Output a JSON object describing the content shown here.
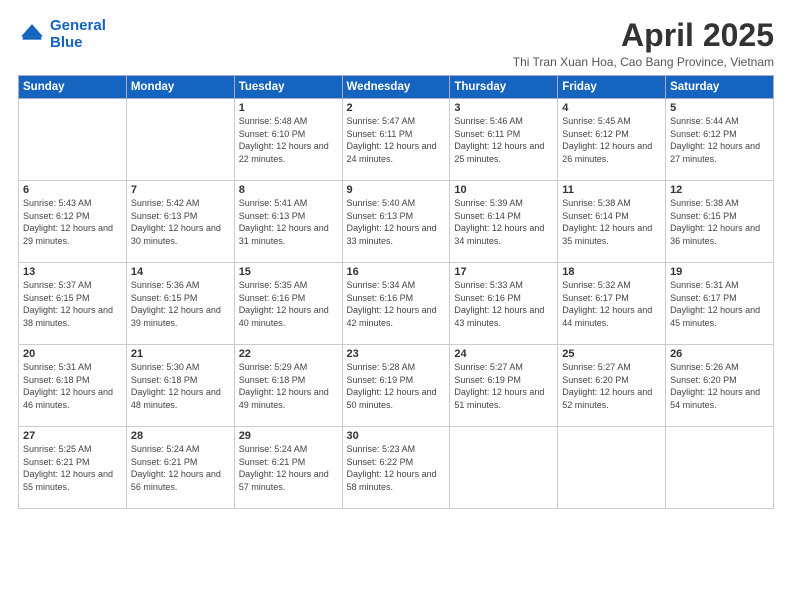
{
  "logo": {
    "line1": "General",
    "line2": "Blue"
  },
  "title": "April 2025",
  "subtitle": "Thi Tran Xuan Hoa, Cao Bang Province, Vietnam",
  "days_of_week": [
    "Sunday",
    "Monday",
    "Tuesday",
    "Wednesday",
    "Thursday",
    "Friday",
    "Saturday"
  ],
  "weeks": [
    [
      {
        "day": "",
        "info": ""
      },
      {
        "day": "",
        "info": ""
      },
      {
        "day": "1",
        "info": "Sunrise: 5:48 AM\nSunset: 6:10 PM\nDaylight: 12 hours and 22 minutes."
      },
      {
        "day": "2",
        "info": "Sunrise: 5:47 AM\nSunset: 6:11 PM\nDaylight: 12 hours and 24 minutes."
      },
      {
        "day": "3",
        "info": "Sunrise: 5:46 AM\nSunset: 6:11 PM\nDaylight: 12 hours and 25 minutes."
      },
      {
        "day": "4",
        "info": "Sunrise: 5:45 AM\nSunset: 6:12 PM\nDaylight: 12 hours and 26 minutes."
      },
      {
        "day": "5",
        "info": "Sunrise: 5:44 AM\nSunset: 6:12 PM\nDaylight: 12 hours and 27 minutes."
      }
    ],
    [
      {
        "day": "6",
        "info": "Sunrise: 5:43 AM\nSunset: 6:12 PM\nDaylight: 12 hours and 29 minutes."
      },
      {
        "day": "7",
        "info": "Sunrise: 5:42 AM\nSunset: 6:13 PM\nDaylight: 12 hours and 30 minutes."
      },
      {
        "day": "8",
        "info": "Sunrise: 5:41 AM\nSunset: 6:13 PM\nDaylight: 12 hours and 31 minutes."
      },
      {
        "day": "9",
        "info": "Sunrise: 5:40 AM\nSunset: 6:13 PM\nDaylight: 12 hours and 33 minutes."
      },
      {
        "day": "10",
        "info": "Sunrise: 5:39 AM\nSunset: 6:14 PM\nDaylight: 12 hours and 34 minutes."
      },
      {
        "day": "11",
        "info": "Sunrise: 5:38 AM\nSunset: 6:14 PM\nDaylight: 12 hours and 35 minutes."
      },
      {
        "day": "12",
        "info": "Sunrise: 5:38 AM\nSunset: 6:15 PM\nDaylight: 12 hours and 36 minutes."
      }
    ],
    [
      {
        "day": "13",
        "info": "Sunrise: 5:37 AM\nSunset: 6:15 PM\nDaylight: 12 hours and 38 minutes."
      },
      {
        "day": "14",
        "info": "Sunrise: 5:36 AM\nSunset: 6:15 PM\nDaylight: 12 hours and 39 minutes."
      },
      {
        "day": "15",
        "info": "Sunrise: 5:35 AM\nSunset: 6:16 PM\nDaylight: 12 hours and 40 minutes."
      },
      {
        "day": "16",
        "info": "Sunrise: 5:34 AM\nSunset: 6:16 PM\nDaylight: 12 hours and 42 minutes."
      },
      {
        "day": "17",
        "info": "Sunrise: 5:33 AM\nSunset: 6:16 PM\nDaylight: 12 hours and 43 minutes."
      },
      {
        "day": "18",
        "info": "Sunrise: 5:32 AM\nSunset: 6:17 PM\nDaylight: 12 hours and 44 minutes."
      },
      {
        "day": "19",
        "info": "Sunrise: 5:31 AM\nSunset: 6:17 PM\nDaylight: 12 hours and 45 minutes."
      }
    ],
    [
      {
        "day": "20",
        "info": "Sunrise: 5:31 AM\nSunset: 6:18 PM\nDaylight: 12 hours and 46 minutes."
      },
      {
        "day": "21",
        "info": "Sunrise: 5:30 AM\nSunset: 6:18 PM\nDaylight: 12 hours and 48 minutes."
      },
      {
        "day": "22",
        "info": "Sunrise: 5:29 AM\nSunset: 6:18 PM\nDaylight: 12 hours and 49 minutes."
      },
      {
        "day": "23",
        "info": "Sunrise: 5:28 AM\nSunset: 6:19 PM\nDaylight: 12 hours and 50 minutes."
      },
      {
        "day": "24",
        "info": "Sunrise: 5:27 AM\nSunset: 6:19 PM\nDaylight: 12 hours and 51 minutes."
      },
      {
        "day": "25",
        "info": "Sunrise: 5:27 AM\nSunset: 6:20 PM\nDaylight: 12 hours and 52 minutes."
      },
      {
        "day": "26",
        "info": "Sunrise: 5:26 AM\nSunset: 6:20 PM\nDaylight: 12 hours and 54 minutes."
      }
    ],
    [
      {
        "day": "27",
        "info": "Sunrise: 5:25 AM\nSunset: 6:21 PM\nDaylight: 12 hours and 55 minutes."
      },
      {
        "day": "28",
        "info": "Sunrise: 5:24 AM\nSunset: 6:21 PM\nDaylight: 12 hours and 56 minutes."
      },
      {
        "day": "29",
        "info": "Sunrise: 5:24 AM\nSunset: 6:21 PM\nDaylight: 12 hours and 57 minutes."
      },
      {
        "day": "30",
        "info": "Sunrise: 5:23 AM\nSunset: 6:22 PM\nDaylight: 12 hours and 58 minutes."
      },
      {
        "day": "",
        "info": ""
      },
      {
        "day": "",
        "info": ""
      },
      {
        "day": "",
        "info": ""
      }
    ]
  ]
}
